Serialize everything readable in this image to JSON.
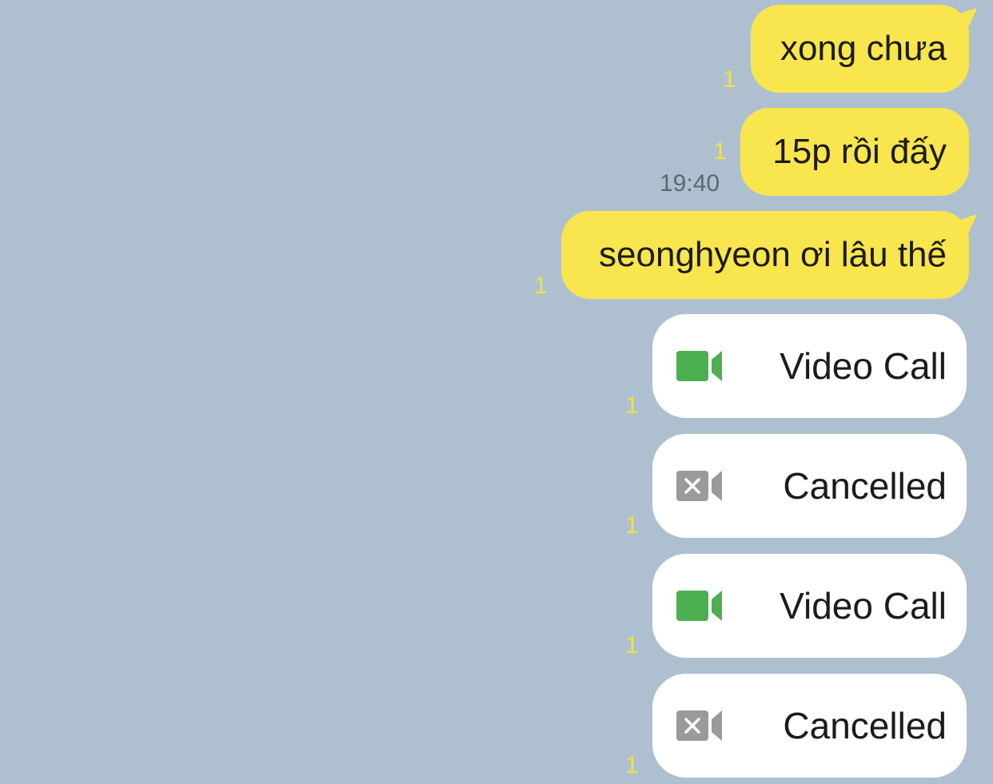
{
  "colors": {
    "background": "#aec0d0",
    "bubble_yellow": "#f9e64e",
    "unread_yellow": "#f3e244",
    "call_green": "#4caf50",
    "cancel_gray": "#9a9a9a"
  },
  "messages": [
    {
      "text": "xong chưa",
      "unread": "1"
    },
    {
      "text": "15p rồi đấy",
      "unread": "1",
      "time": "19:40"
    },
    {
      "text": "seonghyeon ơi lâu thế",
      "unread": "1"
    }
  ],
  "calls": [
    {
      "label": "Video Call",
      "icon": "video-camera-icon",
      "unread": "1"
    },
    {
      "label": "Cancelled",
      "icon": "video-cancelled-icon",
      "unread": "1"
    },
    {
      "label": "Video Call",
      "icon": "video-camera-icon",
      "unread": "1"
    },
    {
      "label": "Cancelled",
      "icon": "video-cancelled-icon",
      "unread": "1"
    }
  ]
}
